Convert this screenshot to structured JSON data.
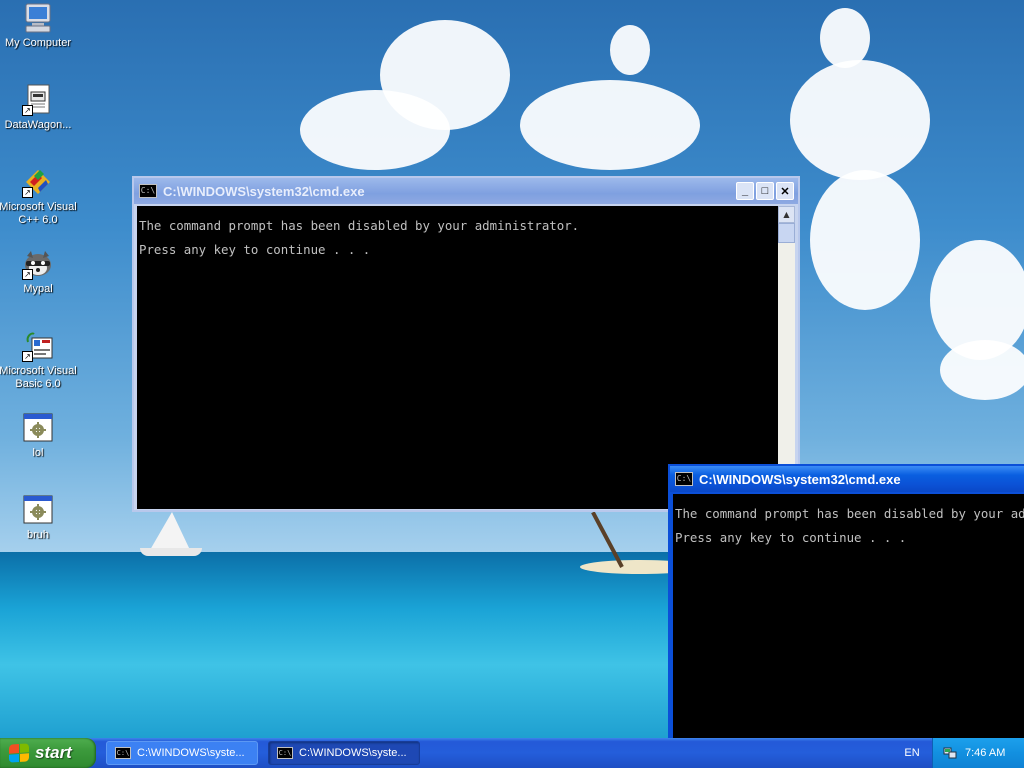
{
  "desktop": {
    "icons": [
      {
        "label": "My Computer",
        "icon": "computer-icon"
      },
      {
        "label": "DataWagon...",
        "icon": "document-shortcut-icon"
      },
      {
        "label": "Microsoft Visual C++ 6.0",
        "icon": "visual-cpp-icon"
      },
      {
        "label": "Mypal",
        "icon": "mypal-raccoon-icon"
      },
      {
        "label": "Microsoft Visual Basic 6.0",
        "icon": "visual-basic-icon"
      },
      {
        "label": "lol",
        "icon": "batch-file-icon"
      },
      {
        "label": "bruh",
        "icon": "batch-file-icon"
      }
    ]
  },
  "windows": [
    {
      "title": "C:\\WINDOWS\\system32\\cmd.exe",
      "state": "inactive",
      "lines": [
        "The command prompt has been disabled by your administrator.",
        "Press any key to continue . . ."
      ]
    },
    {
      "title": "C:\\WINDOWS\\system32\\cmd.exe",
      "state": "active",
      "lines": [
        "The command prompt has been disabled by your administrator.",
        "Press any key to continue . . ."
      ]
    }
  ],
  "window_controls": {
    "minimize": "_",
    "maximize": "□",
    "close": "✕"
  },
  "cmd_icon_text": "C:\\",
  "taskbar": {
    "start_label": "start",
    "buttons": [
      {
        "label": "C:\\WINDOWS\\syste...",
        "icon": "cmd-icon"
      },
      {
        "label": "C:\\WINDOWS\\syste...",
        "icon": "cmd-icon"
      }
    ],
    "language": "EN",
    "clock": "7:46 AM"
  },
  "colors": {
    "taskbar": "#245edb",
    "start_button": "#3c9a3c",
    "active_title": "#0a5fe0",
    "inactive_title": "#7fa0e0",
    "console_bg": "#000000",
    "console_text": "#c0c0c0"
  }
}
